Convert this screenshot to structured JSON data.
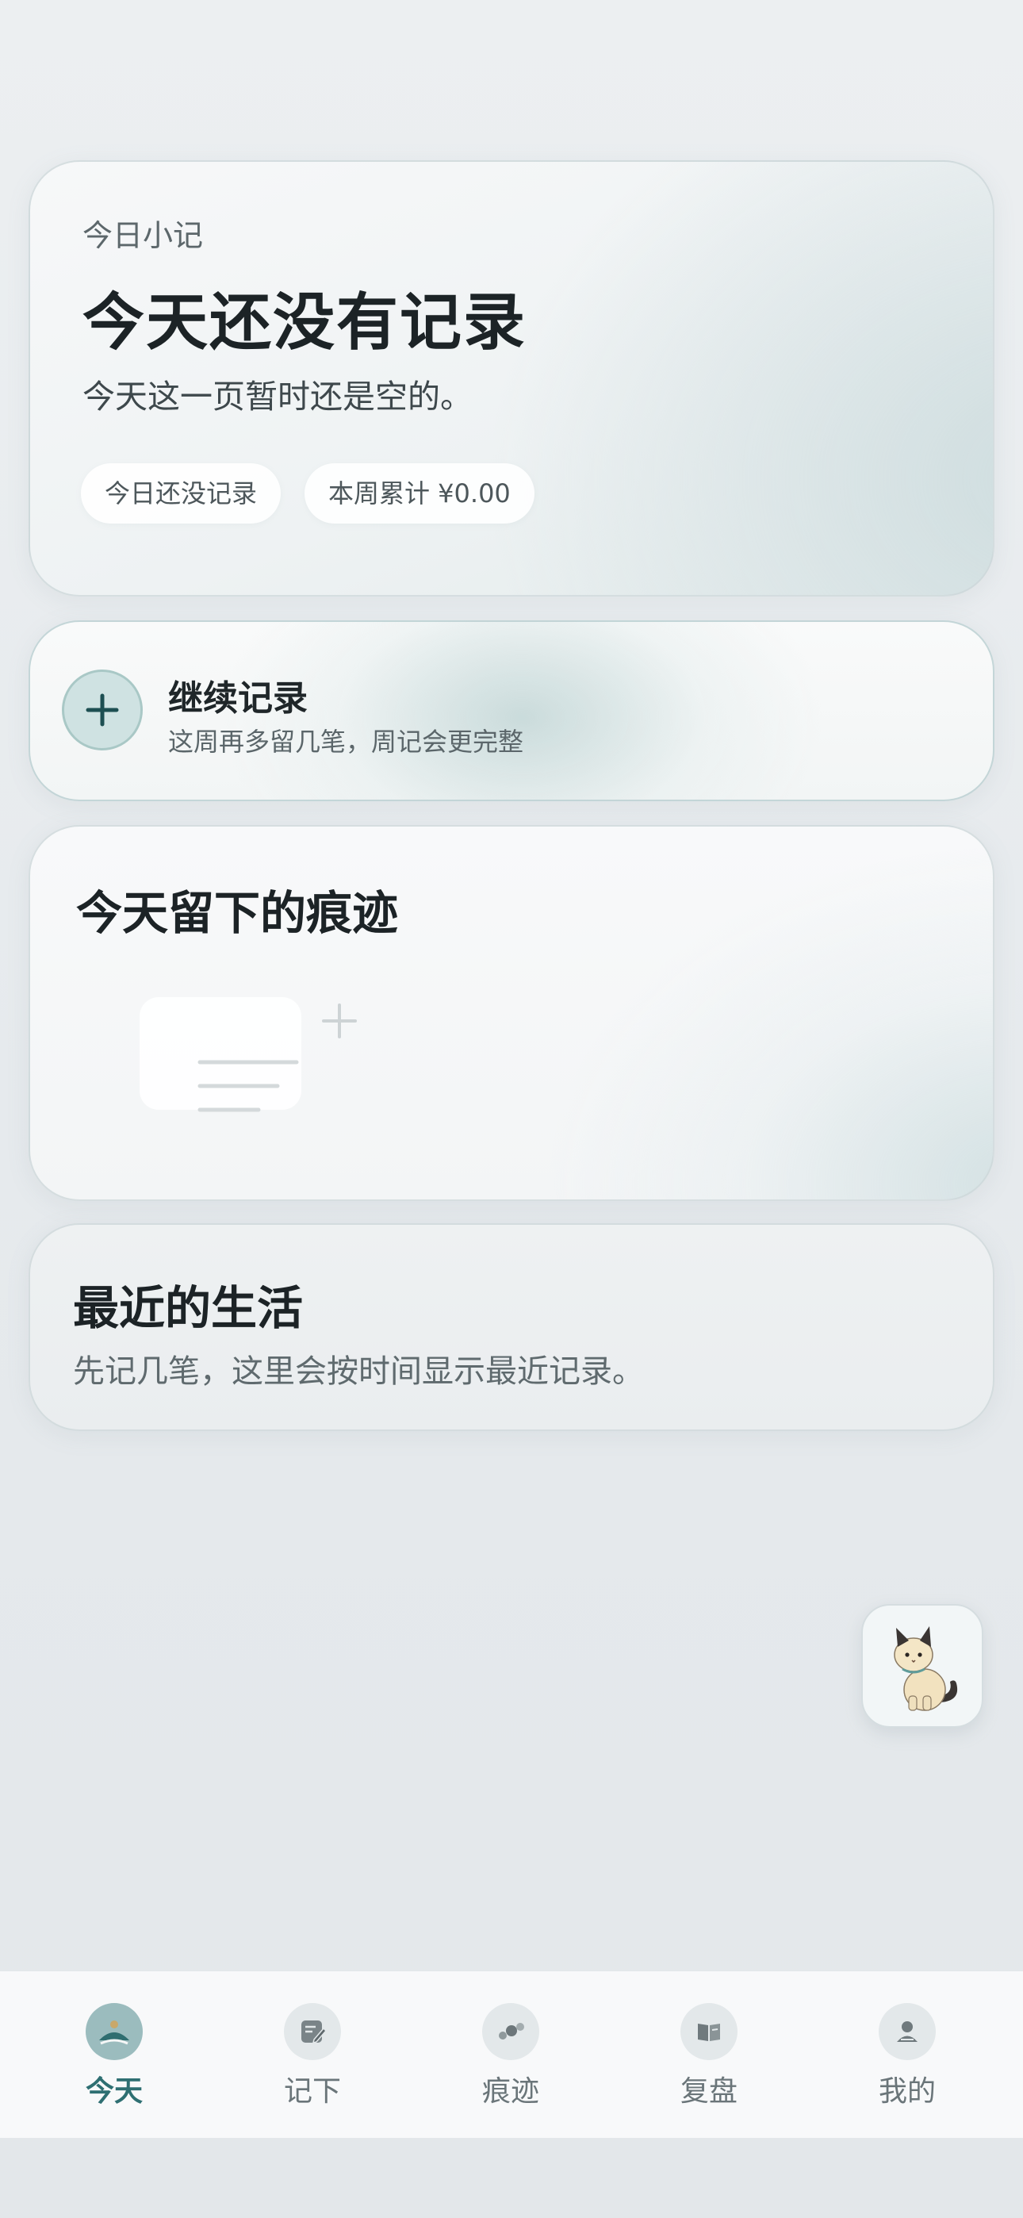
{
  "today_card": {
    "eyebrow": "今日小记",
    "title": "今天还没有记录",
    "subtitle": "今天这一页暂时还是空的。",
    "chips": [
      "今日还没记录",
      "本周累计 ¥0.00"
    ]
  },
  "continue_card": {
    "icon": "plus-icon",
    "title": "继续记录",
    "subtitle": "这周再多留几笔，周记会更完整"
  },
  "traces_card": {
    "title": "今天留下的痕迹"
  },
  "recent_card": {
    "title": "最近的生活",
    "subtitle": "先记几笔，这里会按时间显示最近记录。"
  },
  "pet": {
    "icon": "cat-icon"
  },
  "tab_bar": {
    "active": "今天",
    "tabs": [
      {
        "label": "今天",
        "icon": "sunrise-icon"
      },
      {
        "label": "记下",
        "icon": "note-edit-icon"
      },
      {
        "label": "痕迹",
        "icon": "dots-icon"
      },
      {
        "label": "复盘",
        "icon": "book-icon"
      },
      {
        "label": "我的",
        "icon": "person-icon"
      }
    ]
  },
  "colors": {
    "accent": "#2e6f72",
    "active_tab_bg": "#9bbcbe",
    "text_primary": "#1c2326"
  }
}
